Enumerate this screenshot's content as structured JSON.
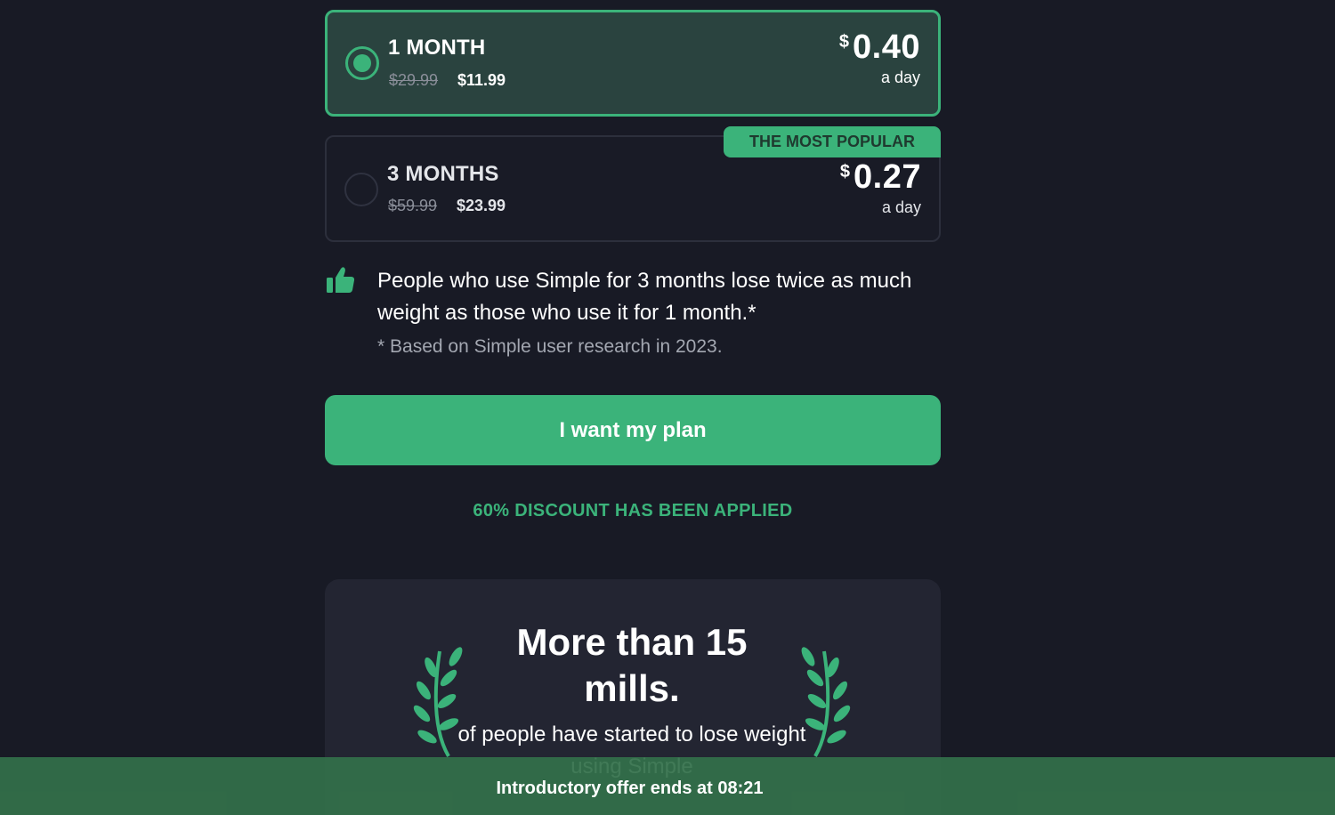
{
  "plans": [
    {
      "name": "1 MONTH",
      "old_price": "$29.99",
      "new_price": "$11.99",
      "currency": "$",
      "per_day_price": "0.40",
      "per_day_label": "a day",
      "selected": true
    },
    {
      "name": "3 MONTHS",
      "old_price": "$59.99",
      "new_price": "$23.99",
      "currency": "$",
      "per_day_price": "0.27",
      "per_day_label": "a day",
      "badge": "THE MOST POPULAR",
      "selected": false
    }
  ],
  "info": {
    "icon": "thumbs-up-icon",
    "text": "People who use Simple for 3 months lose twice as much weight as those who use it for 1 month.*",
    "footnote": "* Based on Simple user research in 2023."
  },
  "cta": {
    "label": "I want my plan"
  },
  "discount_notice": "60% DISCOUNT HAS BEEN APPLIED",
  "social_proof": {
    "headline": "More than 15 mills.",
    "subtext": "of people have started to lose weight using Simple"
  },
  "offer_banner": {
    "text": "Introductory offer ends at 08:21"
  },
  "colors": {
    "accent": "#3bb37a",
    "background": "#181a25",
    "selected_card": "#2a433f",
    "banner": "#33704a"
  }
}
